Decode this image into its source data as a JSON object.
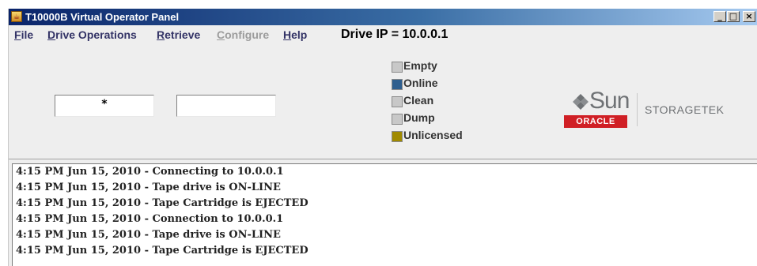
{
  "window": {
    "title": "T10000B Virtual Operator Panel",
    "app_icon": "java-icon",
    "controls": [
      "minimize-icon",
      "maximize-icon",
      "close-icon"
    ]
  },
  "menu": {
    "items": [
      {
        "label": "File",
        "mnemonic": "F",
        "rest": "ile",
        "enabled": true
      },
      {
        "label": "Drive Operations",
        "mnemonic": "D",
        "rest": "rive Operations",
        "enabled": true
      },
      {
        "label": "Retrieve",
        "mnemonic": "R",
        "rest": "etrieve",
        "enabled": true
      },
      {
        "label": "Configure",
        "mnemonic": "C",
        "rest": "onfigure",
        "enabled": false
      },
      {
        "label": "Help",
        "mnemonic": "H",
        "rest": "elp",
        "enabled": true
      }
    ],
    "drive_ip": "Drive IP = 10.0.0.1"
  },
  "display": {
    "left_value": "*",
    "right_value": ""
  },
  "legend": [
    {
      "label": "Empty",
      "color": "#c8c8c8"
    },
    {
      "label": "Online",
      "color": "#2f5f8f"
    },
    {
      "label": "Clean",
      "color": "#c8c8c8"
    },
    {
      "label": "Dump",
      "color": "#c8c8c8"
    },
    {
      "label": "Unlicensed",
      "color": "#a08a00"
    }
  ],
  "logo": {
    "brand": "Sun",
    "oracle": "ORACLE",
    "product": "STORAGETEK",
    "colors": {
      "oracle_red": "#d01f25",
      "sun_gray": "#6f7275"
    }
  },
  "log": [
    "4:15 PM Jun 15, 2010 - Connecting to 10.0.0.1",
    "4:15 PM Jun 15, 2010 - Tape drive is ON-LINE",
    "4:15 PM Jun 15, 2010 - Tape Cartridge is EJECTED",
    "4:15 PM Jun 15, 2010 - Connection to 10.0.0.1",
    "4:15 PM Jun 15, 2010 - Tape drive is ON-LINE",
    "4:15 PM Jun 15, 2010 - Tape Cartridge is EJECTED"
  ]
}
